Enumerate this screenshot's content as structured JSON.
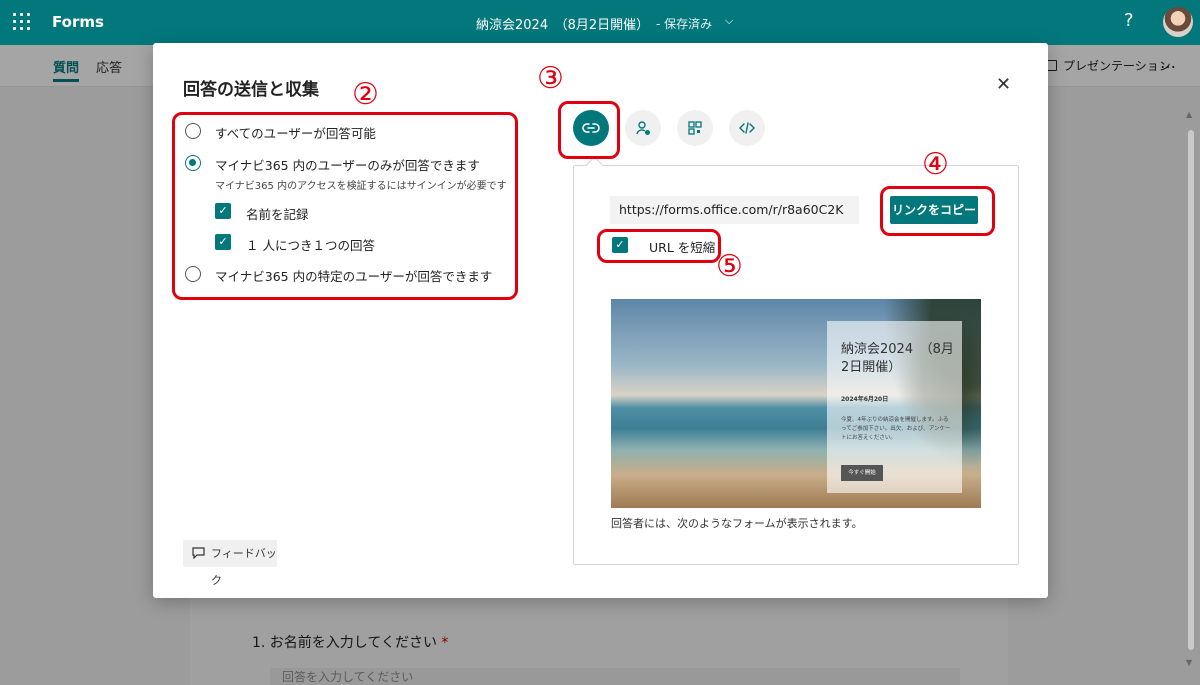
{
  "topbar": {
    "app_name": "Forms",
    "doc_title": "納涼会2024　（8月2日開催）",
    "doc_status": "- 保存済み",
    "chevron": "⌵",
    "help": "?"
  },
  "subbar": {
    "tabs": [
      {
        "label": "質問",
        "active": true
      },
      {
        "label": "応答",
        "active": false
      }
    ],
    "present_label": "プレゼンテーション",
    "more": "…"
  },
  "background_form": {
    "question": "1. お名前を入力してください",
    "required_mark": "*",
    "input_placeholder": "回答を入力してください"
  },
  "modal": {
    "title": "回答の送信と収集",
    "close": "✕",
    "options": [
      {
        "label": "すべてのユーザーが回答可能",
        "selected": false
      },
      {
        "label": "マイナビ365 内のユーザーのみが回答できます",
        "selected": true,
        "description": "マイナビ365 内のアクセスを検証するにはサインインが必要です"
      },
      {
        "label": "マイナビ365 内の特定のユーザーが回答できます",
        "selected": false
      }
    ],
    "suboptions": [
      {
        "label": "名前を記録",
        "checked": true
      },
      {
        "label": "１ 人につき１つの回答",
        "checked": true
      }
    ],
    "feedback_label": "フィードバック",
    "share_tabs": [
      "link-icon",
      "person-add-icon",
      "qr-code-icon",
      "embed-code-icon"
    ],
    "link_panel": {
      "url": "https://forms.office.com/r/r8a60C2K",
      "copy_label": "リンクをコピー",
      "shorten_label": "URL を短縮",
      "shorten_checked": true,
      "preview": {
        "title": "納涼会2024　（8月2日開催）",
        "date": "2024年6月20日",
        "body": "今夏、4年ぶりの納涼会を開催します。ふるってご参加下さい。出欠、および、アンケートにお答えください。",
        "button": "今すぐ開始"
      },
      "caption": "回答者には、次のようなフォームが表示されます。"
    }
  },
  "callouts": [
    "②",
    "③",
    "④",
    "⑤"
  ],
  "colors": {
    "accent": "#03787c",
    "highlight": "#e0000f"
  }
}
